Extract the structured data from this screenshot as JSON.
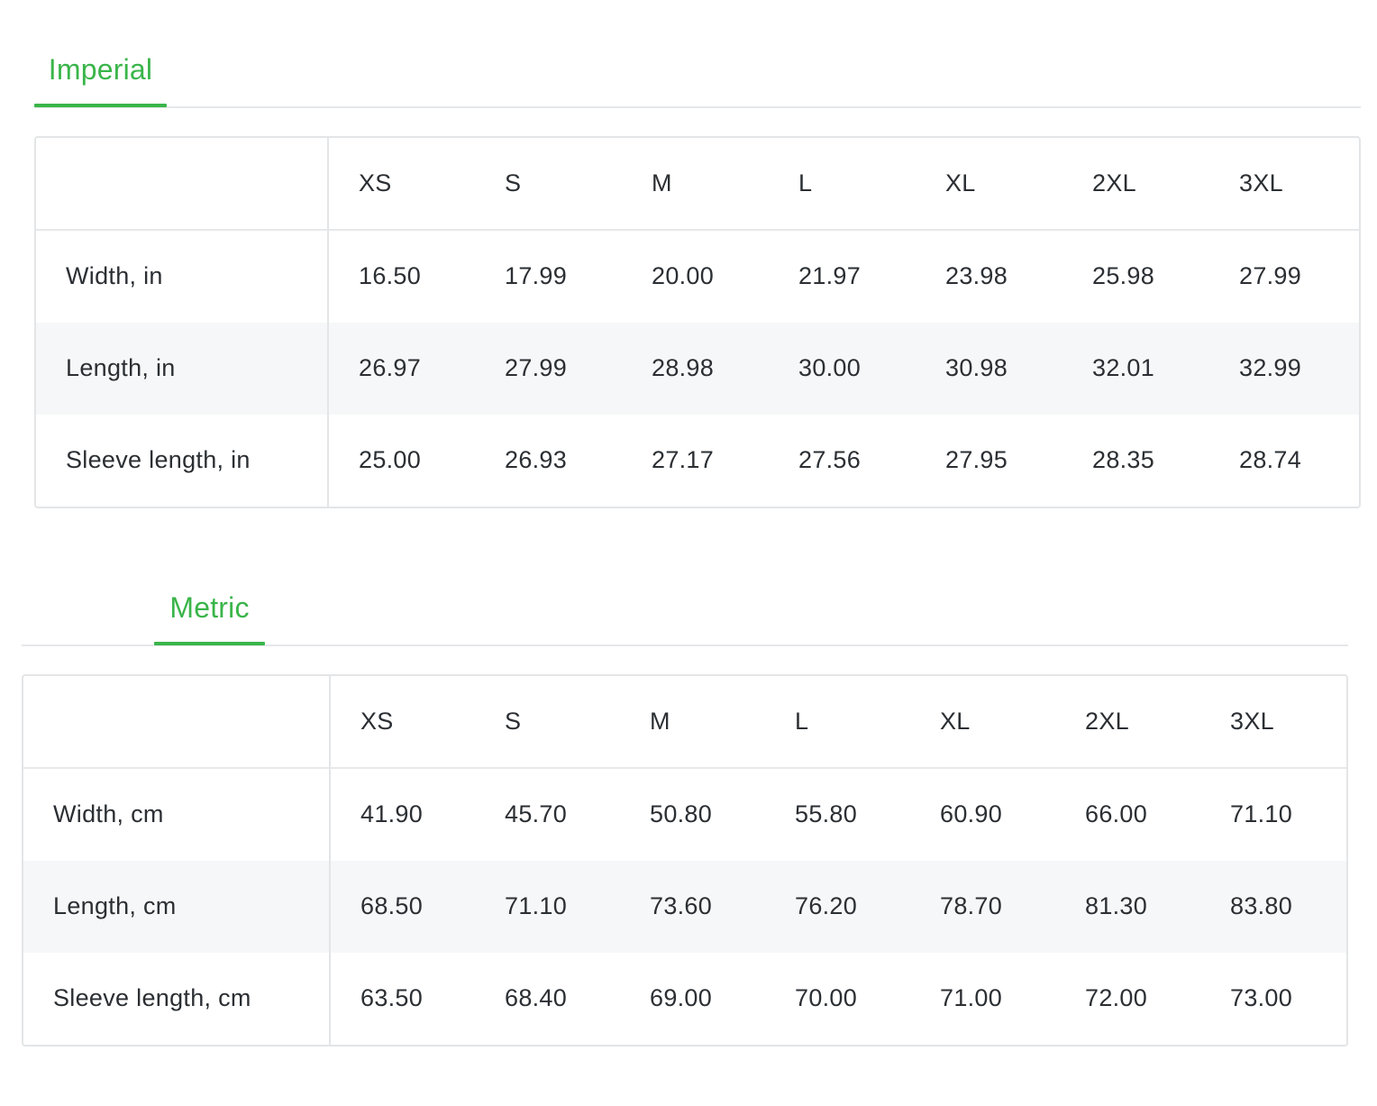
{
  "imperial": {
    "tab_label": "Imperial",
    "headers": [
      "",
      "XS",
      "S",
      "M",
      "L",
      "XL",
      "2XL",
      "3XL"
    ],
    "rows": [
      {
        "label": "Width, in",
        "values": [
          "16.50",
          "17.99",
          "20.00",
          "21.97",
          "23.98",
          "25.98",
          "27.99"
        ]
      },
      {
        "label": "Length, in",
        "values": [
          "26.97",
          "27.99",
          "28.98",
          "30.00",
          "30.98",
          "32.01",
          "32.99"
        ]
      },
      {
        "label": "Sleeve length, in",
        "values": [
          "25.00",
          "26.93",
          "27.17",
          "27.56",
          "27.95",
          "28.35",
          "28.74"
        ]
      }
    ]
  },
  "metric": {
    "tab_label": "Metric",
    "headers": [
      "",
      "XS",
      "S",
      "M",
      "L",
      "XL",
      "2XL",
      "3XL"
    ],
    "rows": [
      {
        "label": "Width, cm",
        "values": [
          "41.90",
          "45.70",
          "50.80",
          "55.80",
          "60.90",
          "66.00",
          "71.10"
        ]
      },
      {
        "label": "Length, cm",
        "values": [
          "68.50",
          "71.10",
          "73.60",
          "76.20",
          "78.70",
          "81.30",
          "83.80"
        ]
      },
      {
        "label": "Sleeve length, cm",
        "values": [
          "63.50",
          "68.40",
          "69.00",
          "70.00",
          "71.00",
          "72.00",
          "73.00"
        ]
      }
    ]
  },
  "colors": {
    "accent": "#3ab54a",
    "border": "#e3e5e7",
    "row_shade": "#f6f7f8",
    "text": "#2b2f33"
  }
}
